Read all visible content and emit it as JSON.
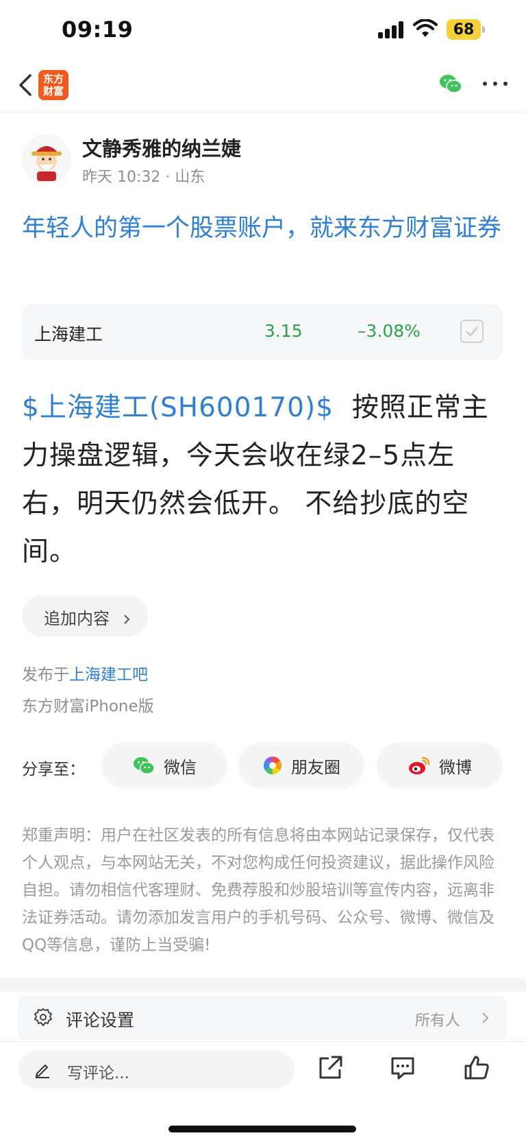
{
  "status_bar": {
    "time": "09:19",
    "battery": "68"
  },
  "nav": {
    "logo_text": "东方\n财富"
  },
  "author": {
    "name": "文静秀雅的纳兰婕",
    "meta": "昨天 10:32 · 山东"
  },
  "post": {
    "title": "年轻人的第一个股票账户，就来东方财富证券",
    "stock": {
      "name": "上海建工",
      "price": "3.15",
      "change": "–3.08%"
    },
    "body_link": "$上海建工(SH600170)$",
    "body_text": "按照正常主力操盘逻辑，今天会收在绿2–5点左右，明天仍然会低开。 不给抄底的空间。",
    "append_label": "追加内容",
    "published_prefix": "发布于",
    "published_forum": "上海建工吧",
    "client": "东方财富iPhone版"
  },
  "share": {
    "label": "分享至：",
    "wechat": "微信",
    "moments": "朋友圈",
    "weibo": "微博"
  },
  "disclaimer": "郑重声明：用户在社区发表的所有信息将由本网站记录保存，仅代表个人观点，与本网站无关，不对您构成任何投资建议，据此操作风险自担。请勿相信代客理财、免费荐股和炒股培训等宣传内容，远离非法证券活动。请勿添加发言用户的手机号码、公众号、微博、微信及QQ等信息，谨防上当受骗!",
  "comment_settings": {
    "label": "评论设置",
    "value": "所有人"
  },
  "bottom": {
    "placeholder": "写评论..."
  },
  "colors": {
    "accent": "#2f7fd3",
    "down": "#2aa34a",
    "brand": "#f25b1d"
  }
}
